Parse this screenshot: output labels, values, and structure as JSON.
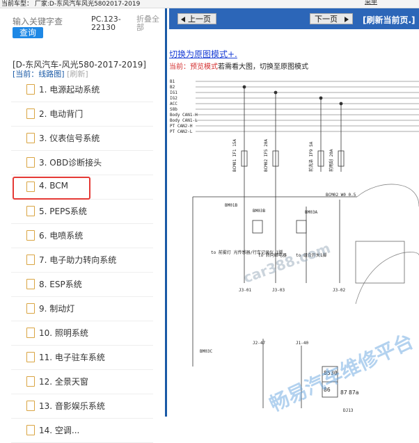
{
  "topbar": {
    "vehicle": "当前车型： 厂家:D-东风汽车风光5802017-2019",
    "right_button": "菜单"
  },
  "left": {
    "search_placeholder": "输入关键字查",
    "search_button": "查询",
    "code": "PC.123-22130",
    "collapse": "折叠全部",
    "tree_title": "[D-东风汽车-风光580-2017-2019]",
    "tree_current": "[当前：线路图]",
    "tree_refresh": "[刷新]",
    "items": [
      {
        "label": "1. 电源起动系统"
      },
      {
        "label": "2. 电动背门"
      },
      {
        "label": "3. 仪表信号系统"
      },
      {
        "label": "3. OBD诊断接头"
      },
      {
        "label": "4. BCM"
      },
      {
        "label": "5. PEPS系统"
      },
      {
        "label": "6. 电喷系统"
      },
      {
        "label": "7. 电子助力转向系统"
      },
      {
        "label": "8. ESP系统"
      },
      {
        "label": "9. 制动灯"
      },
      {
        "label": "10. 照明系统"
      },
      {
        "label": "11. 电子驻车系统"
      },
      {
        "label": "12. 全景天窗"
      },
      {
        "label": "13. 音影娱乐系统"
      },
      {
        "label": "14. 空调..."
      }
    ]
  },
  "right": {
    "prev": "上一页",
    "next": "下一页",
    "refresh": "[刷新当前页.]",
    "switch_link": "切换为原图模式+.",
    "current_label": "当前：",
    "current_mode": "预览模式",
    "current_hint": "若需看大图，切换至原图模式"
  },
  "diagram": {
    "rails": [
      "B1",
      "B2",
      "IG1",
      "IG2",
      "ACC",
      "S8b",
      "Body CAN1-H",
      "Body CAN1-L",
      "PT CAN2-H",
      "PT CAN2-L"
    ],
    "fuses": [
      "BCM01 IF1 15A",
      "BCM02 IF5 20A",
      "前洗涤 IF9 5A",
      "前雨刮 20A"
    ],
    "labels": [
      "BM01B",
      "BM03B",
      "BM03A",
      "to 前雾灯 光传感器/行车记录仪 1脚",
      "to 转向继电器",
      "to 组合开关1脚",
      "J3-01",
      "J3-03",
      "J3-02",
      "J2-47",
      "J1-40",
      "BM03C",
      "85",
      "30",
      "86",
      "87",
      "87a",
      "DJ13",
      "BCM02 W0 0.5"
    ],
    "watermark": "畅易汽车维修平台",
    "watermark_url": "car388.com"
  }
}
